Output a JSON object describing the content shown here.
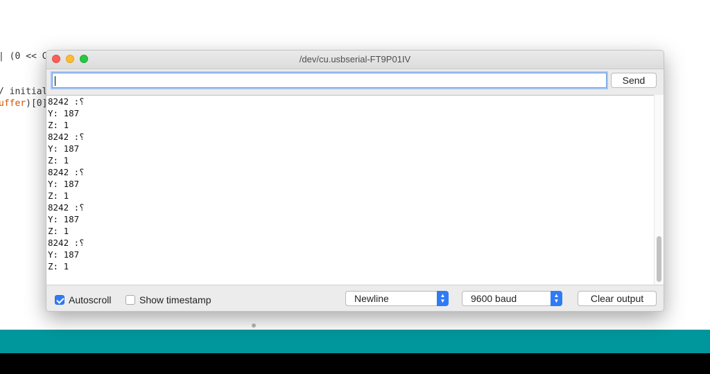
{
  "editor": {
    "line1": "| (0 << C",
    "line2": "/ initial",
    "line3_prefix": "uffer",
    "line3_suffix": ")[0]"
  },
  "window": {
    "title": "/dev/cu.usbserial-FT9P01IV"
  },
  "send": {
    "input_value": "",
    "button_label": "Send"
  },
  "output_lines": [
    "؟: 8242",
    "Y: 187",
    "Z: 1",
    "؟: 8242",
    "Y: 187",
    "Z: 1",
    "؟: 8242",
    "Y: 187",
    "Z: 1",
    "؟: 8242",
    "Y: 187",
    "Z: 1",
    "؟: 8242",
    "Y: 187",
    "Z: 1"
  ],
  "footer": {
    "autoscroll_label": "Autoscroll",
    "autoscroll_checked": true,
    "timestamp_label": "Show timestamp",
    "timestamp_checked": false,
    "line_ending": "Newline",
    "baud_rate": "9600 baud",
    "clear_label": "Clear output"
  },
  "colors": {
    "status_bar": "#00979c",
    "accent": "#2f7bf5"
  }
}
